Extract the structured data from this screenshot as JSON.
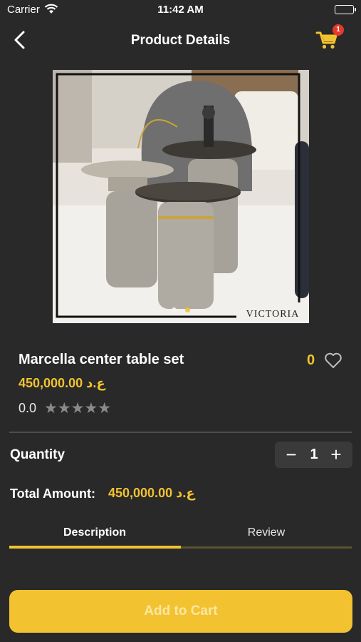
{
  "status_bar": {
    "carrier": "Carrier",
    "time": "11:42 AM"
  },
  "header": {
    "title": "Product Details",
    "cart_badge": "1"
  },
  "product": {
    "image_brand": "VICTORIA",
    "name": "Marcella center table set",
    "likes": "0",
    "price": "450,000.00 ع.د",
    "rating": "0.0",
    "stars": "★★★★★",
    "stars_filled": 0,
    "stars_total": 5,
    "carousel_active_index": 1
  },
  "quantity": {
    "label": "Quantity",
    "minus": "−",
    "value": "1",
    "plus": "+"
  },
  "total": {
    "label": "Total Amount:",
    "value": "450,000.00 ع.د"
  },
  "tabs": [
    {
      "label": "Description",
      "active": true
    },
    {
      "label": "Review",
      "active": false
    }
  ],
  "cta": {
    "label": "Add to Cart"
  },
  "colors": {
    "background": "#292929",
    "accent": "#f2c230",
    "badge": "#e43a2b",
    "muted": "#8a8a8a"
  },
  "icons": [
    "wifi-icon",
    "battery-icon",
    "back-arrow-icon",
    "cart-icon",
    "heart-icon",
    "star-icon"
  ]
}
